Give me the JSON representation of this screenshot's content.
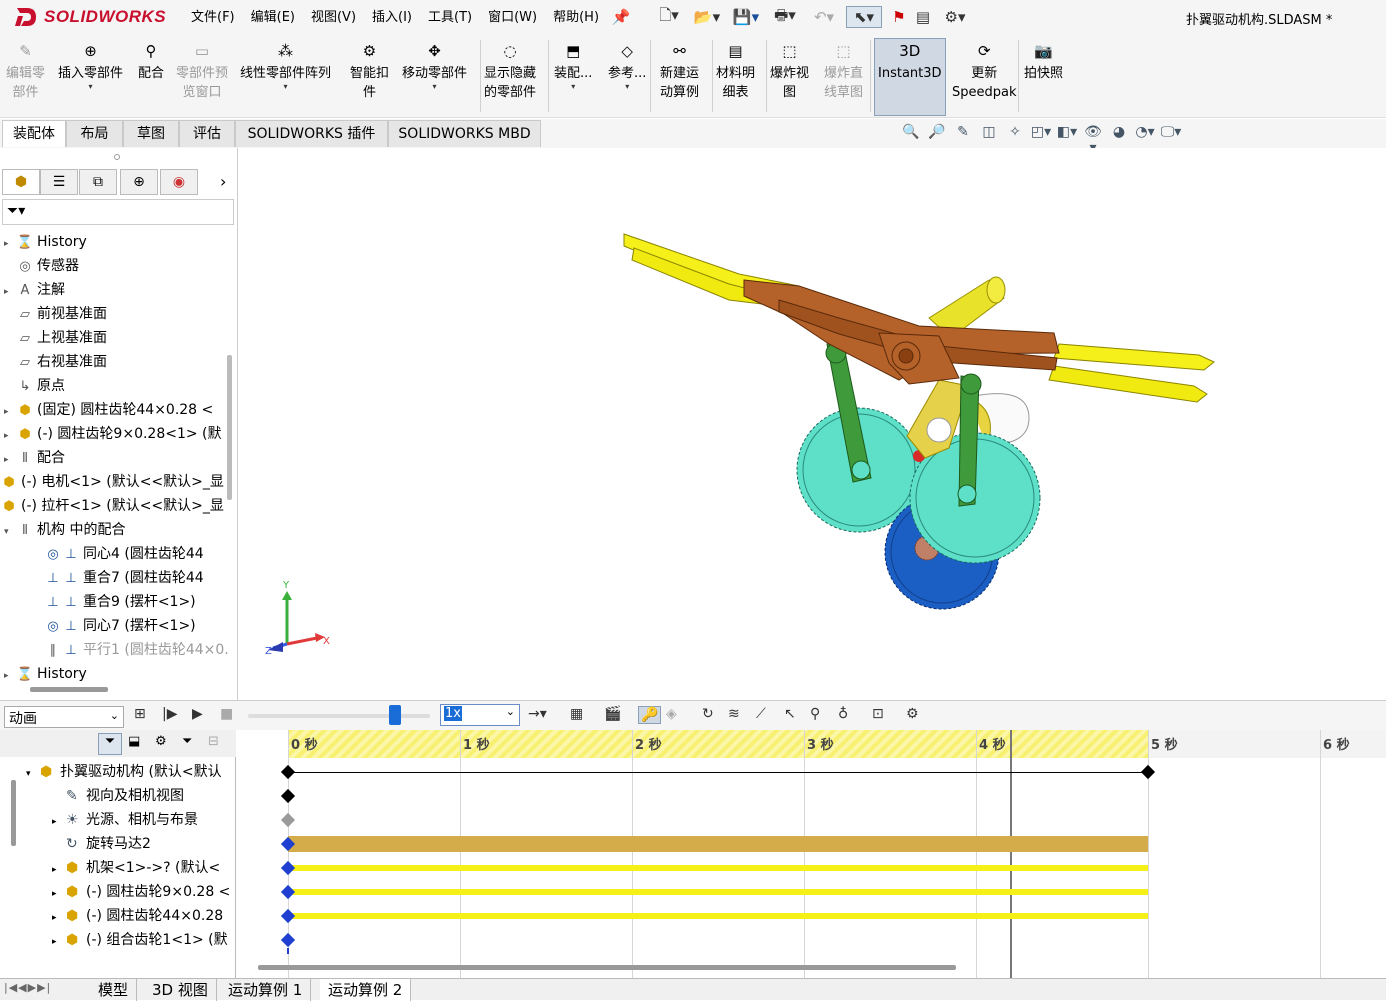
{
  "app": {
    "logo": "SOLIDWORKS",
    "document_title": "扑翼驱动机构.SLDASM *"
  },
  "menu": [
    "文件(F)",
    "编辑(E)",
    "视图(V)",
    "插入(I)",
    "工具(T)",
    "窗口(W)",
    "帮助(H)"
  ],
  "commands": [
    {
      "line1": "编辑零",
      "line2": "部件",
      "enabled": false,
      "icon": "edit-component-icon"
    },
    {
      "line1": "插入零部件",
      "line2": "",
      "enabled": true,
      "icon": "insert-component-icon"
    },
    {
      "line1": "配合",
      "line2": "",
      "enabled": true,
      "icon": "mate-icon"
    },
    {
      "line1": "零部件预",
      "line2": "览窗口",
      "enabled": false,
      "icon": "preview-window-icon"
    },
    {
      "line1": "线性零部件阵列",
      "line2": "",
      "enabled": true,
      "icon": "linear-pattern-icon"
    },
    {
      "line1": "智能扣",
      "line2": "件",
      "enabled": true,
      "icon": "smart-fastener-icon"
    },
    {
      "line1": "移动零部件",
      "line2": "",
      "enabled": true,
      "icon": "move-component-icon"
    },
    {
      "line1": "显示隐藏",
      "line2": "的零部件",
      "enabled": true,
      "icon": "show-hidden-icon"
    },
    {
      "line1": "装配...",
      "line2": "",
      "enabled": true,
      "icon": "assembly-features-icon"
    },
    {
      "line1": "参考...",
      "line2": "",
      "enabled": true,
      "icon": "reference-geometry-icon"
    },
    {
      "line1": "新建运",
      "line2": "动算例",
      "enabled": true,
      "icon": "new-motion-study-icon"
    },
    {
      "line1": "材料明",
      "line2": "细表",
      "enabled": true,
      "icon": "bom-icon"
    },
    {
      "line1": "爆炸视",
      "line2": "图",
      "enabled": true,
      "icon": "exploded-view-icon"
    },
    {
      "line1": "爆炸直",
      "line2": "线草图",
      "enabled": false,
      "icon": "explode-line-icon"
    },
    {
      "line1": "Instant3D",
      "line2": "",
      "enabled": true,
      "icon": "instant3d-icon"
    },
    {
      "line1": "更新",
      "line2": "Speedpak",
      "enabled": true,
      "icon": "speedpak-icon"
    },
    {
      "line1": "拍快照",
      "line2": "",
      "enabled": true,
      "icon": "snapshot-icon"
    }
  ],
  "command_tabs": [
    "装配体",
    "布局",
    "草图",
    "评估",
    "SOLIDWORKS 插件",
    "SOLIDWORKS MBD"
  ],
  "feature_tree": [
    {
      "label": "History",
      "toggle": "▸",
      "icon": "history-icon",
      "indent": 0,
      "dim": false
    },
    {
      "label": "传感器",
      "toggle": "",
      "icon": "sensor-icon",
      "indent": 0,
      "dim": false
    },
    {
      "label": "注解",
      "toggle": "▸",
      "icon": "annotation-icon",
      "indent": 0,
      "dim": false
    },
    {
      "label": "前视基准面",
      "toggle": "",
      "icon": "plane-icon",
      "indent": 0,
      "dim": false
    },
    {
      "label": "上视基准面",
      "toggle": "",
      "icon": "plane-icon",
      "indent": 0,
      "dim": false
    },
    {
      "label": "右视基准面",
      "toggle": "",
      "icon": "plane-icon",
      "indent": 0,
      "dim": false
    },
    {
      "label": "原点",
      "toggle": "",
      "icon": "origin-icon",
      "indent": 0,
      "dim": false
    },
    {
      "label": "(固定) 圆柱齿轮44×0.28 <",
      "toggle": "▸",
      "icon": "part-icon",
      "indent": 0,
      "dim": false
    },
    {
      "label": "(-) 圆柱齿轮9×0.28<1> (默",
      "toggle": "▸",
      "icon": "part-icon",
      "indent": 0,
      "dim": false
    },
    {
      "label": "配合",
      "toggle": "▸",
      "icon": "mates-folder-icon",
      "indent": 0,
      "dim": false
    },
    {
      "label": "(-) 电机<1> (默认<<默认>_显",
      "toggle": "",
      "icon": "part-icon",
      "indent": -1,
      "dim": false
    },
    {
      "label": "(-) 拉杆<1> (默认<<默认>_显",
      "toggle": "",
      "icon": "part-icon",
      "indent": -1,
      "dim": false
    },
    {
      "label": "机构 中的配合",
      "toggle": "▾",
      "icon": "mates-folder-icon",
      "indent": 0,
      "dim": false
    },
    {
      "label": "同心4 (圆柱齿轮44",
      "toggle": "",
      "icon": "concentric-icon",
      "indent": 2,
      "dim": false
    },
    {
      "label": "重合7 (圆柱齿轮44",
      "toggle": "",
      "icon": "coincident-icon",
      "indent": 2,
      "dim": false
    },
    {
      "label": "重合9 (摆杆<1>)",
      "toggle": "",
      "icon": "coincident-icon",
      "indent": 2,
      "dim": false
    },
    {
      "label": "同心7 (摆杆<1>)",
      "toggle": "",
      "icon": "concentric-icon",
      "indent": 2,
      "dim": false
    },
    {
      "label": "平行1 (圆柱齿轮44×0.",
      "toggle": "",
      "icon": "parallel-icon",
      "indent": 2,
      "dim": true
    },
    {
      "label": "History",
      "toggle": "▸",
      "icon": "history-icon",
      "indent": 0,
      "dim": false
    }
  ],
  "animation": {
    "study_type": "动画",
    "playback_speed": "1x",
    "playback_slider_fraction": 0.81
  },
  "motion_tree": [
    {
      "label": "扑翼驱动机构 (默认<默认",
      "toggle": "▾",
      "icon": "assembly-icon"
    },
    {
      "label": "视向及相机视图",
      "toggle": "",
      "icon": "camera-icon"
    },
    {
      "label": "光源、相机与布景",
      "toggle": "▸",
      "icon": "lights-icon"
    },
    {
      "label": "旋转马达2",
      "toggle": "",
      "icon": "rotary-motor-icon"
    },
    {
      "label": "机架<1>->? (默认<",
      "toggle": "▸",
      "icon": "part-icon"
    },
    {
      "label": "(-) 圆柱齿轮9×0.28 <",
      "toggle": "▸",
      "icon": "part-icon"
    },
    {
      "label": "(-) 圆柱齿轮44×0.28",
      "toggle": "▸",
      "icon": "part-icon"
    },
    {
      "label": "(-) 组合齿轮1<1> (默",
      "toggle": "▸",
      "icon": "part-icon"
    }
  ],
  "timeline": {
    "ticks": [
      "0 秒",
      "1 秒",
      "2 秒",
      "3 秒",
      "4 秒",
      "5 秒",
      "6 秒"
    ],
    "duration_s": 5,
    "time_bar_s": 4.2
  },
  "bottom_tabs": [
    "模型",
    "3D 视图",
    "运动算例 1",
    "运动算例 2"
  ],
  "triad": {
    "x": "X",
    "y": "Y",
    "z": "Z"
  },
  "colors": {
    "accent": "#1a6dd6",
    "logo_red": "#c8102e",
    "gear_teal": "#5ee0c8",
    "gear_blue": "#1b5fc4",
    "linkage_brown": "#b5622a",
    "rod_green": "#3e9a3a",
    "wing_yellow": "#f5ef1a",
    "motor_bar": "#d4ad4a"
  }
}
